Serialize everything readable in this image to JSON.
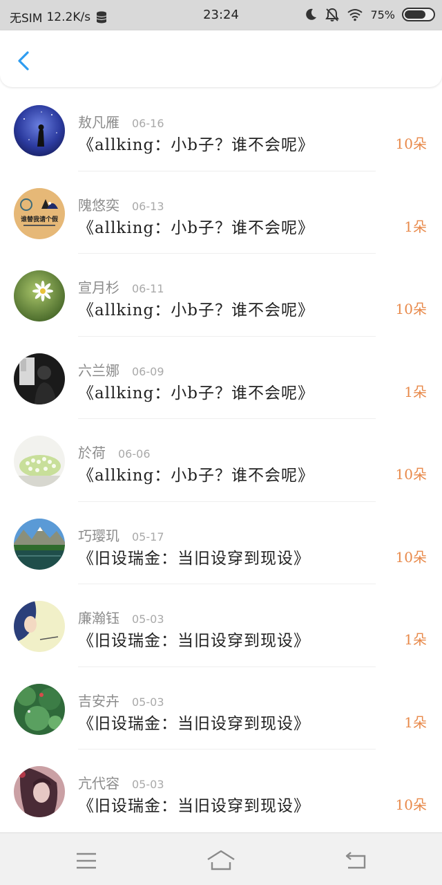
{
  "status_bar": {
    "carrier": "无SIM",
    "speed": "12.2K/s",
    "time": "23:24",
    "battery": "75%",
    "battery_level": 0.75
  },
  "header": {
    "back_icon": "chevron-left-icon",
    "accent": "#2e9cf0"
  },
  "colors": {
    "amount": "#e8894a",
    "name": "#8c8c8c"
  },
  "items": [
    {
      "name": "敖凡雁",
      "date": "06-16",
      "title": "《allking：小b子？谁不会呢》",
      "amount": "10朵"
    },
    {
      "name": "隗悠奕",
      "date": "06-13",
      "title": "《allking：小b子？谁不会呢》",
      "amount": "1朵"
    },
    {
      "name": "宣月杉",
      "date": "06-11",
      "title": "《allking：小b子？谁不会呢》",
      "amount": "10朵"
    },
    {
      "name": "六兰娜",
      "date": "06-09",
      "title": "《allking：小b子？谁不会呢》",
      "amount": "1朵"
    },
    {
      "name": "於荷",
      "date": "06-06",
      "title": "《allking：小b子？谁不会呢》",
      "amount": "10朵"
    },
    {
      "name": "巧璎玑",
      "date": "05-17",
      "title": "《旧设瑞金：当旧设穿到现设》",
      "amount": "10朵"
    },
    {
      "name": "廉瀚钰",
      "date": "05-03",
      "title": "《旧设瑞金：当旧设穿到现设》",
      "amount": "1朵"
    },
    {
      "name": "吉安卉",
      "date": "05-03",
      "title": "《旧设瑞金：当旧设穿到现设》",
      "amount": "1朵"
    },
    {
      "name": "亢代容",
      "date": "05-03",
      "title": "《旧设瑞金：当旧设穿到现设》",
      "amount": "10朵"
    }
  ],
  "avatar_2_text": "谁替我请个假",
  "navbar": {
    "icons": [
      "menu-icon",
      "home-icon",
      "back-icon"
    ]
  }
}
